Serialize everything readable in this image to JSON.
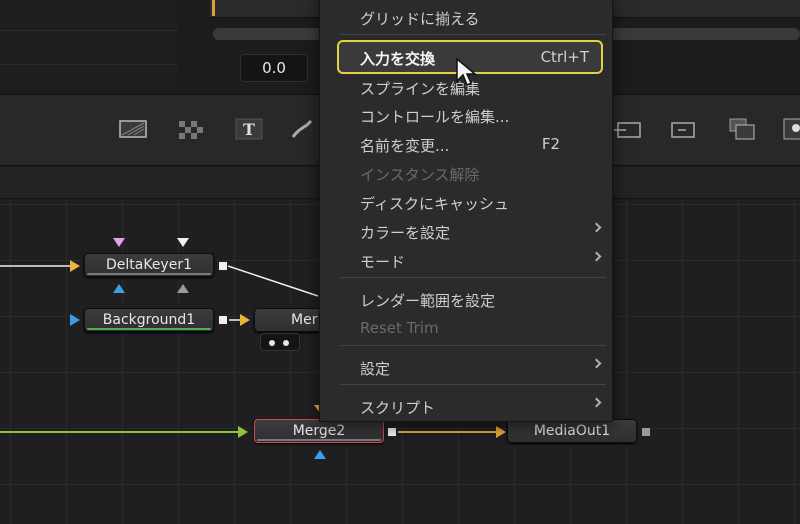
{
  "top": {
    "value_field": "0.0"
  },
  "toolbar": {
    "icons": [
      "background-tool-icon",
      "checker-pattern-icon",
      "text-tool-icon",
      "paint-brush-icon",
      "merge-tool-icon",
      "transform-tool-icon",
      "channel-tool-icon",
      "media-out-tool-icon"
    ]
  },
  "nodes": {
    "deltakeyer": "DeltaKeyer1",
    "background": "Background1",
    "merge1": "Mer",
    "merge2": "Merge2",
    "mediaout": "MediaOut1"
  },
  "colors": {
    "input_yellow": "#e8b43a",
    "input_blue": "#3a9ee8",
    "input_pink": "#e89ee8",
    "link_green": "#8fc43a",
    "link_orange": "#e8a83a",
    "highlight_border": "#e6d33a",
    "selected_border": "#d24a4a"
  },
  "context_menu": {
    "items": [
      {
        "label": "グリッドに揃える",
        "shortcut": "",
        "disabled": false,
        "submenu": false
      },
      {
        "label": "入力を交換",
        "shortcut": "Ctrl+T",
        "disabled": false,
        "submenu": false,
        "highlighted": true
      },
      {
        "label": "スプラインを編集",
        "shortcut": "",
        "disabled": false,
        "submenu": false
      },
      {
        "label": "コントロールを編集...",
        "shortcut": "",
        "disabled": false,
        "submenu": false
      },
      {
        "label": "名前を変更...",
        "shortcut": "F2",
        "disabled": false,
        "submenu": false
      },
      {
        "label": "インスタンス解除",
        "shortcut": "",
        "disabled": true,
        "submenu": false
      },
      {
        "label": "ディスクにキャッシュ",
        "shortcut": "",
        "disabled": false,
        "submenu": false
      },
      {
        "label": "カラーを設定",
        "shortcut": "",
        "disabled": false,
        "submenu": true
      },
      {
        "label": "モード",
        "shortcut": "",
        "disabled": false,
        "submenu": true
      },
      {
        "label": "レンダー範囲を設定",
        "shortcut": "",
        "disabled": false,
        "submenu": false
      },
      {
        "label": "Reset Trim",
        "shortcut": "",
        "disabled": true,
        "submenu": false
      },
      {
        "label": "設定",
        "shortcut": "",
        "disabled": false,
        "submenu": true
      },
      {
        "label": "スクリプト",
        "shortcut": "",
        "disabled": false,
        "submenu": true
      }
    ]
  }
}
